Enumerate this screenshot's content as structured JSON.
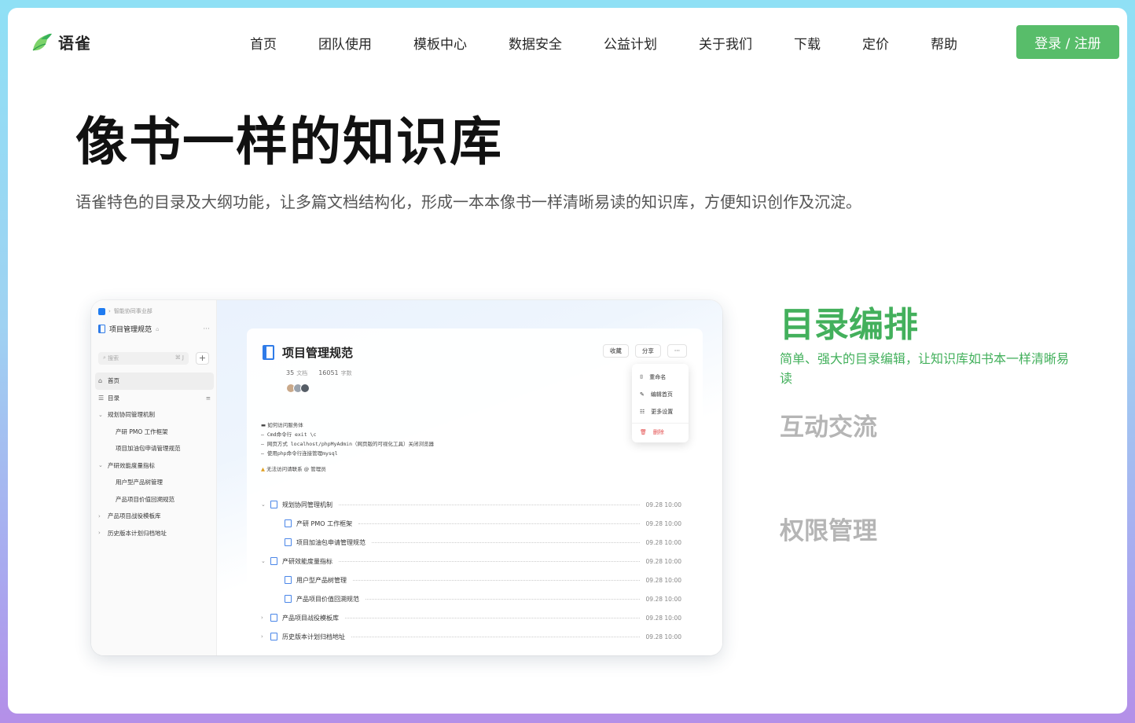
{
  "brand": {
    "name": "语雀",
    "accent": "#58bd6a",
    "title_green": "#43b05c"
  },
  "nav": {
    "items": [
      "首页",
      "团队使用",
      "模板中心",
      "数据安全",
      "公益计划",
      "关于我们",
      "下载",
      "定价",
      "帮助"
    ],
    "login_label": "登录 / 注册"
  },
  "hero": {
    "title": "像书一样的知识库",
    "subtitle": "语雀特色的目录及大纲功能，让多篇文档结构化，形成一本本像书一样清晰易读的知识库，方便知识创作及沉淀。"
  },
  "mockup": {
    "sidebar": {
      "breadcrumb": "智能协同事业部",
      "book_title": "项目管理规范",
      "search_placeholder": "搜索",
      "search_shortcut": "⌘ J",
      "items": [
        {
          "label": "首页",
          "level": 1,
          "icon": "home-icon"
        },
        {
          "label": "目录",
          "level": 1,
          "icon": "toc-icon"
        },
        {
          "label": "规划协同管理机制",
          "level": 1,
          "expanded": true
        },
        {
          "label": "产研 PMO 工作框架",
          "level": 2
        },
        {
          "label": "项目加油包申请管理规范",
          "level": 2
        },
        {
          "label": "产研效能度量指标",
          "level": 1,
          "expanded": true
        },
        {
          "label": "用户型产品树管理",
          "level": 2
        },
        {
          "label": "产品项目价值回溯规范",
          "level": 2
        },
        {
          "label": "产品项目战役模板库",
          "level": 1,
          "expanded": false
        },
        {
          "label": "历史版本计划归档地址",
          "level": 1,
          "expanded": false
        }
      ]
    },
    "doc": {
      "title": "项目管理规范",
      "doc_count": "35",
      "doc_unit": "文档",
      "word_count": "16051",
      "word_unit": "字数",
      "buttons": {
        "collect": "收藏",
        "share": "分享",
        "more": "···"
      },
      "menu": [
        "重命名",
        "编辑首页",
        "更多设置",
        "删除"
      ],
      "notes": {
        "heading": "如何访问服务体",
        "lines": [
          "–   Cmd命令行 exit \\c",
          "–   网页方式 localhost/phpMyAdmin（网页版的可视化工具）关闭浏览器",
          "–   使用php命令行连接管理mysql"
        ],
        "warning": "无法访问请联系 @ 管理员"
      },
      "toc": [
        {
          "label": "规划协同管理机制",
          "level": 1,
          "chevron": "⌄",
          "time": "09.28 10:00"
        },
        {
          "label": "产研 PMO 工作框架",
          "level": 2,
          "time": "09.28 10:00"
        },
        {
          "label": "项目加油包申请管理规范",
          "level": 2,
          "time": "09.28 10:00"
        },
        {
          "label": "产研效能度量指标",
          "level": 1,
          "chevron": "⌄",
          "time": "09.28 10:00"
        },
        {
          "label": "用户型产品树管理",
          "level": 2,
          "time": "09.28 10:00"
        },
        {
          "label": "产品项目价值回溯规范",
          "level": 2,
          "time": "09.28 10:00"
        },
        {
          "label": "产品项目战役模板库",
          "level": 1,
          "chevron": "›",
          "time": "09.28 10:00"
        },
        {
          "label": "历史版本计划归档地址",
          "level": 1,
          "chevron": "›",
          "time": "09.28 10:00"
        }
      ]
    }
  },
  "features": {
    "active": {
      "title": "目录编排",
      "desc": "简单、强大的目录编辑，让知识库如书本一样清晰易读"
    },
    "second": "互动交流",
    "third": "权限管理"
  }
}
